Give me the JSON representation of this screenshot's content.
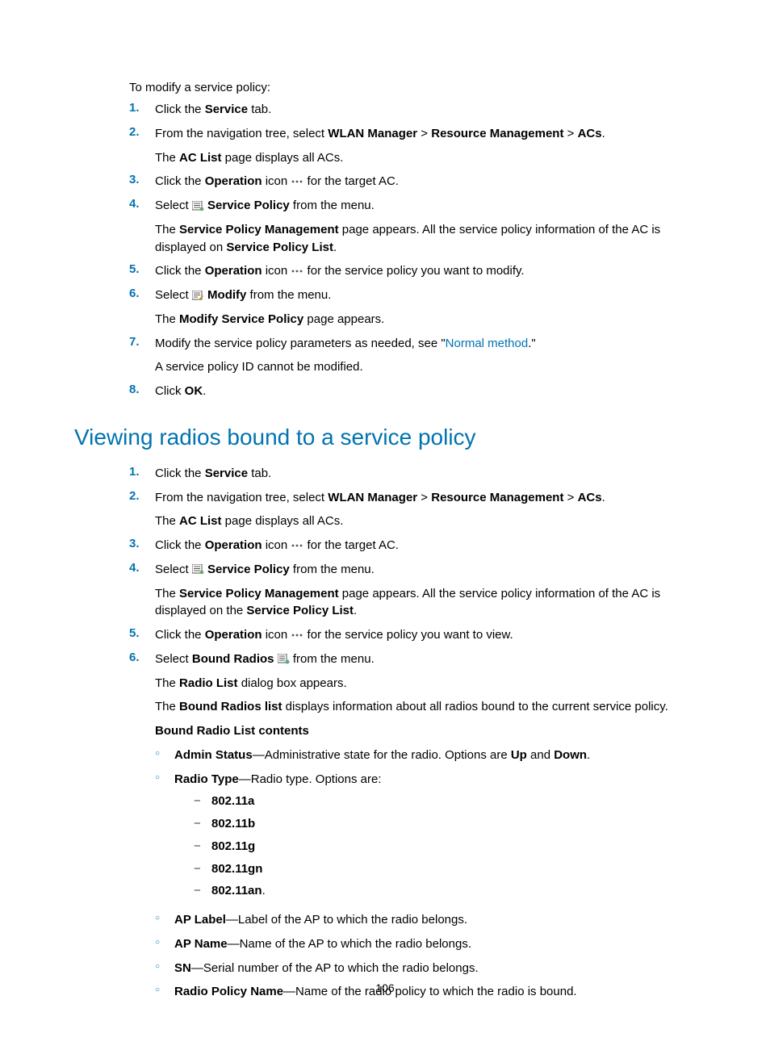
{
  "pageNumber": "106",
  "sectionA": {
    "intro": "To modify a service policy:",
    "steps": [
      {
        "num": "1.",
        "lines": [
          {
            "parts": [
              {
                "t": "Click the "
              },
              {
                "t": "Service",
                "b": true
              },
              {
                "t": " tab."
              }
            ]
          }
        ]
      },
      {
        "num": "2.",
        "lines": [
          {
            "parts": [
              {
                "t": "From the navigation tree, select "
              },
              {
                "t": "WLAN Manager",
                "b": true
              },
              {
                "t": " > "
              },
              {
                "t": "Resource Management",
                "b": true
              },
              {
                "t": " > "
              },
              {
                "t": "ACs",
                "b": true
              },
              {
                "t": "."
              }
            ]
          },
          {
            "parts": [
              {
                "t": "The "
              },
              {
                "t": "AC List",
                "b": true
              },
              {
                "t": " page displays all ACs."
              }
            ]
          }
        ]
      },
      {
        "num": "3.",
        "lines": [
          {
            "parts": [
              {
                "t": "Click the "
              },
              {
                "t": "Operation",
                "b": true
              },
              {
                "t": " icon "
              },
              {
                "icon": "dots"
              },
              {
                "t": " for the target AC."
              }
            ]
          }
        ]
      },
      {
        "num": "4.",
        "lines": [
          {
            "parts": [
              {
                "t": "Select "
              },
              {
                "icon": "menu"
              },
              {
                "t": " "
              },
              {
                "t": "Service Policy",
                "b": true
              },
              {
                "t": " from the menu."
              }
            ]
          },
          {
            "parts": [
              {
                "t": "The "
              },
              {
                "t": "Service Policy Management",
                "b": true
              },
              {
                "t": " page appears. All the service policy information of the AC is displayed on "
              },
              {
                "t": "Service Policy List",
                "b": true
              },
              {
                "t": "."
              }
            ]
          }
        ]
      },
      {
        "num": "5.",
        "lines": [
          {
            "parts": [
              {
                "t": "Click the "
              },
              {
                "t": "Operation",
                "b": true
              },
              {
                "t": " icon "
              },
              {
                "icon": "dots"
              },
              {
                "t": " for the service policy you want to modify."
              }
            ]
          }
        ]
      },
      {
        "num": "6.",
        "lines": [
          {
            "parts": [
              {
                "t": "Select "
              },
              {
                "icon": "edit"
              },
              {
                "t": " "
              },
              {
                "t": "Modify",
                "b": true
              },
              {
                "t": " from the menu."
              }
            ]
          },
          {
            "parts": [
              {
                "t": "The "
              },
              {
                "t": "Modify Service Policy",
                "b": true
              },
              {
                "t": " page appears."
              }
            ]
          }
        ]
      },
      {
        "num": "7.",
        "lines": [
          {
            "parts": [
              {
                "t": "Modify the service policy parameters as needed, see \""
              },
              {
                "t": "Normal method",
                "link": true
              },
              {
                "t": ".\""
              }
            ]
          },
          {
            "parts": [
              {
                "t": "A service policy ID cannot be modified."
              }
            ]
          }
        ]
      },
      {
        "num": "8.",
        "lines": [
          {
            "parts": [
              {
                "t": "Click "
              },
              {
                "t": "OK",
                "b": true
              },
              {
                "t": "."
              }
            ]
          }
        ]
      }
    ]
  },
  "sectionB": {
    "heading": "Viewing radios bound to a service policy",
    "steps": [
      {
        "num": "1.",
        "lines": [
          {
            "parts": [
              {
                "t": "Click the "
              },
              {
                "t": "Service",
                "b": true
              },
              {
                "t": " tab."
              }
            ]
          }
        ]
      },
      {
        "num": "2.",
        "lines": [
          {
            "parts": [
              {
                "t": "From the navigation tree, select "
              },
              {
                "t": "WLAN Manager",
                "b": true
              },
              {
                "t": " > "
              },
              {
                "t": "Resource Management",
                "b": true
              },
              {
                "t": " > "
              },
              {
                "t": "ACs",
                "b": true
              },
              {
                "t": "."
              }
            ]
          },
          {
            "parts": [
              {
                "t": "The "
              },
              {
                "t": "AC List",
                "b": true
              },
              {
                "t": " page displays all ACs."
              }
            ]
          }
        ]
      },
      {
        "num": "3.",
        "lines": [
          {
            "parts": [
              {
                "t": "Click the "
              },
              {
                "t": "Operation",
                "b": true
              },
              {
                "t": " icon "
              },
              {
                "icon": "dots"
              },
              {
                "t": " for the target AC."
              }
            ]
          }
        ]
      },
      {
        "num": "4.",
        "lines": [
          {
            "parts": [
              {
                "t": "Select "
              },
              {
                "icon": "menu"
              },
              {
                "t": " "
              },
              {
                "t": "Service Policy",
                "b": true
              },
              {
                "t": " from the menu."
              }
            ]
          },
          {
            "parts": [
              {
                "t": "The "
              },
              {
                "t": "Service Policy Management",
                "b": true
              },
              {
                "t": " page appears. All the service policy information of the AC is displayed on the "
              },
              {
                "t": "Service Policy List",
                "b": true
              },
              {
                "t": "."
              }
            ]
          }
        ]
      },
      {
        "num": "5.",
        "lines": [
          {
            "parts": [
              {
                "t": "Click the "
              },
              {
                "t": "Operation",
                "b": true
              },
              {
                "t": " icon "
              },
              {
                "icon": "dots"
              },
              {
                "t": " for the service policy you want to view."
              }
            ]
          }
        ]
      },
      {
        "num": "6.",
        "lines": [
          {
            "parts": [
              {
                "t": "Select "
              },
              {
                "t": "Bound Radios",
                "b": true
              },
              {
                "t": " "
              },
              {
                "icon": "radios"
              },
              {
                "t": " from the menu."
              }
            ]
          },
          {
            "parts": [
              {
                "t": "The "
              },
              {
                "t": "Radio List",
                "b": true
              },
              {
                "t": " dialog box appears."
              }
            ]
          },
          {
            "parts": [
              {
                "t": "The "
              },
              {
                "t": "Bound Radios list",
                "b": true
              },
              {
                "t": " displays information about all radios bound to the current service policy."
              }
            ]
          },
          {
            "parts": [
              {
                "t": "Bound Radio List contents",
                "b": true
              }
            ]
          }
        ],
        "bullets": [
          {
            "parts": [
              {
                "t": "Admin Status",
                "b": true
              },
              {
                "t": "—Administrative state for the radio. Options are "
              },
              {
                "t": "Up",
                "b": true
              },
              {
                "t": " and "
              },
              {
                "t": "Down",
                "b": true
              },
              {
                "t": "."
              }
            ]
          },
          {
            "parts": [
              {
                "t": "Radio Type",
                "b": true
              },
              {
                "t": "—Radio type. Options are:"
              }
            ],
            "dashes": [
              {
                "parts": [
                  {
                    "t": "802.11a",
                    "b": true
                  }
                ]
              },
              {
                "parts": [
                  {
                    "t": "802.11b",
                    "b": true
                  }
                ]
              },
              {
                "parts": [
                  {
                    "t": "802.11g",
                    "b": true
                  }
                ]
              },
              {
                "parts": [
                  {
                    "t": "802.11gn",
                    "b": true
                  }
                ]
              },
              {
                "parts": [
                  {
                    "t": "802.11an",
                    "b": true
                  },
                  {
                    "t": "."
                  }
                ]
              }
            ]
          },
          {
            "parts": [
              {
                "t": "AP Label",
                "b": true
              },
              {
                "t": "—Label of the AP to which the radio belongs."
              }
            ]
          },
          {
            "parts": [
              {
                "t": "AP Name",
                "b": true
              },
              {
                "t": "—Name of the AP to which the radio belongs."
              }
            ]
          },
          {
            "parts": [
              {
                "t": "SN",
                "b": true
              },
              {
                "t": "—Serial number of the AP to which the radio belongs."
              }
            ]
          },
          {
            "parts": [
              {
                "t": "Radio Policy Name",
                "b": true
              },
              {
                "t": "—Name of the radio policy to which the radio is bound."
              }
            ]
          }
        ]
      }
    ]
  }
}
